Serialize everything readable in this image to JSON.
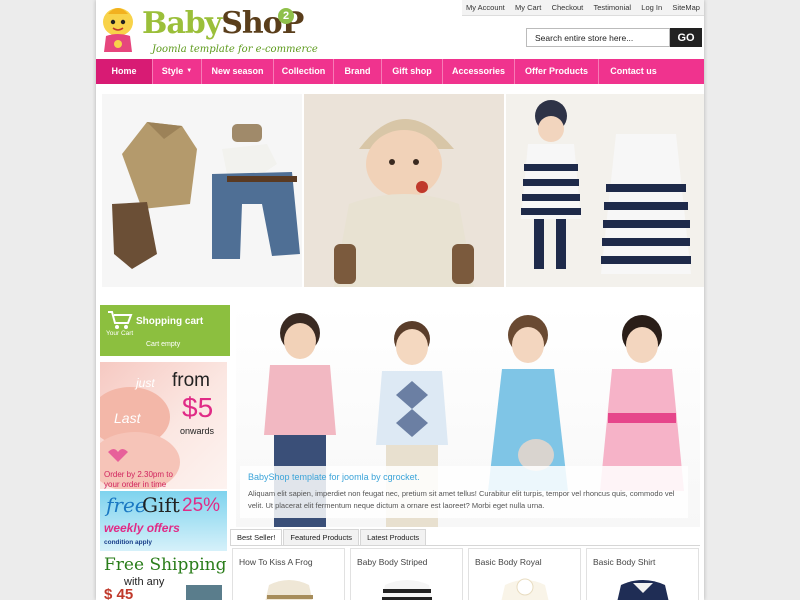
{
  "logo": {
    "name_part1": "Baby",
    "name_part2": "ShoP",
    "version_badge": "2",
    "tagline": "Joomla template for e-commerce"
  },
  "top_links": [
    "My Account",
    "My Cart",
    "Checkout",
    "Testimonial",
    "Log In",
    "SiteMap"
  ],
  "search": {
    "placeholder": "Search entire store here...",
    "button_label": "GO"
  },
  "nav": {
    "items": [
      {
        "label": "Home",
        "active": true
      },
      {
        "label": "Style",
        "has_dropdown": true
      },
      {
        "label": "New season"
      },
      {
        "label": "Collection"
      },
      {
        "label": "Brand"
      },
      {
        "label": "Gift shop"
      },
      {
        "label": "Accessories"
      },
      {
        "label": "Offer Products"
      },
      {
        "label": "Contact us"
      }
    ]
  },
  "cart": {
    "title": "Shopping cart",
    "subtitle": "Your Cart",
    "status": "Cart empty"
  },
  "promo1": {
    "just": "just",
    "from": "from",
    "price": "$5",
    "onwards": "onwards",
    "last": "Last",
    "order_line1": "Order by 2.30pm to",
    "order_line2": "your order in time"
  },
  "promo2": {
    "free": "free",
    "gift": "Gift",
    "percent": "25%",
    "weekly": "weekly offers",
    "condition": "condition apply"
  },
  "promo3": {
    "free_shipping": "Free Shipping",
    "with_any": "with any",
    "amount": "$ 45"
  },
  "slideshow": {
    "title": "BabyShop template for joomla by cgrocket.",
    "text": "Aliquam elit sapien, imperdiet non feugat nec, pretium sit amet tellus! Curabitur elit turpis, tempor vel rhoncus quis, commodo vel velit. Ut placerat elit fermentum neque dictum a ornare est laoreet? Morbi eget nulla urna."
  },
  "tabs": [
    {
      "label": "Best Seller!",
      "active": true
    },
    {
      "label": "Featured Products"
    },
    {
      "label": "Latest Products"
    }
  ],
  "products": [
    {
      "name": "How To Kiss A Frog"
    },
    {
      "name": "Baby Body Striped"
    },
    {
      "name": "Basic Body Royal"
    },
    {
      "name": "Basic Body Shirt"
    }
  ],
  "colors": {
    "brand_pink": "#f0338e",
    "nav_active": "#d81b74",
    "cart_green": "#8cbf3f",
    "logo_green": "#9bbf3a",
    "caption_blue": "#3ba4d9"
  }
}
